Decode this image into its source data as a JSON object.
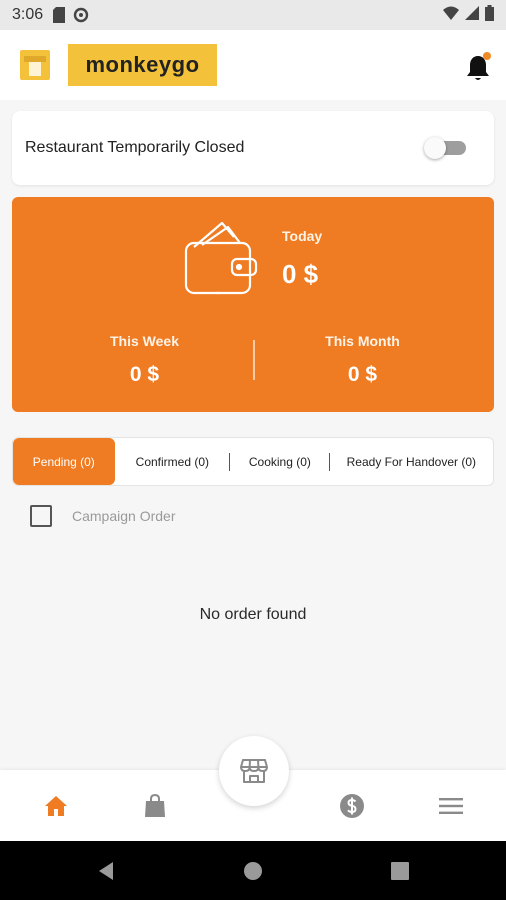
{
  "status_bar": {
    "time": "3:06"
  },
  "app_bar": {
    "brand": "monkeygo"
  },
  "closed_card": {
    "label": "Restaurant Temporarily Closed",
    "toggle_on": false
  },
  "earnings": {
    "today_label": "Today",
    "today_value": "0 $",
    "week_label": "This Week",
    "week_value": "0 $",
    "month_label": "This Month",
    "month_value": "0 $"
  },
  "tabs": [
    {
      "label": "Pending (0)",
      "active": true
    },
    {
      "label": "Confirmed (0)",
      "active": false
    },
    {
      "label": "Cooking (0)",
      "active": false
    },
    {
      "label": "Ready For Handover (0)",
      "active": false
    }
  ],
  "campaign": {
    "label": "Campaign Order",
    "checked": false
  },
  "empty_state": {
    "message": "No order found"
  },
  "bottom_nav": {
    "items": [
      {
        "icon": "home-icon",
        "active": true
      },
      {
        "icon": "shopping-bag-icon",
        "active": false
      },
      {
        "icon": "store-icon",
        "active": false
      },
      {
        "icon": "dollar-icon",
        "active": false
      },
      {
        "icon": "menu-icon",
        "active": false
      }
    ]
  },
  "colors": {
    "accent": "#ef7b22",
    "brand": "#f3c13a",
    "notification_dot": "#f08a24"
  }
}
